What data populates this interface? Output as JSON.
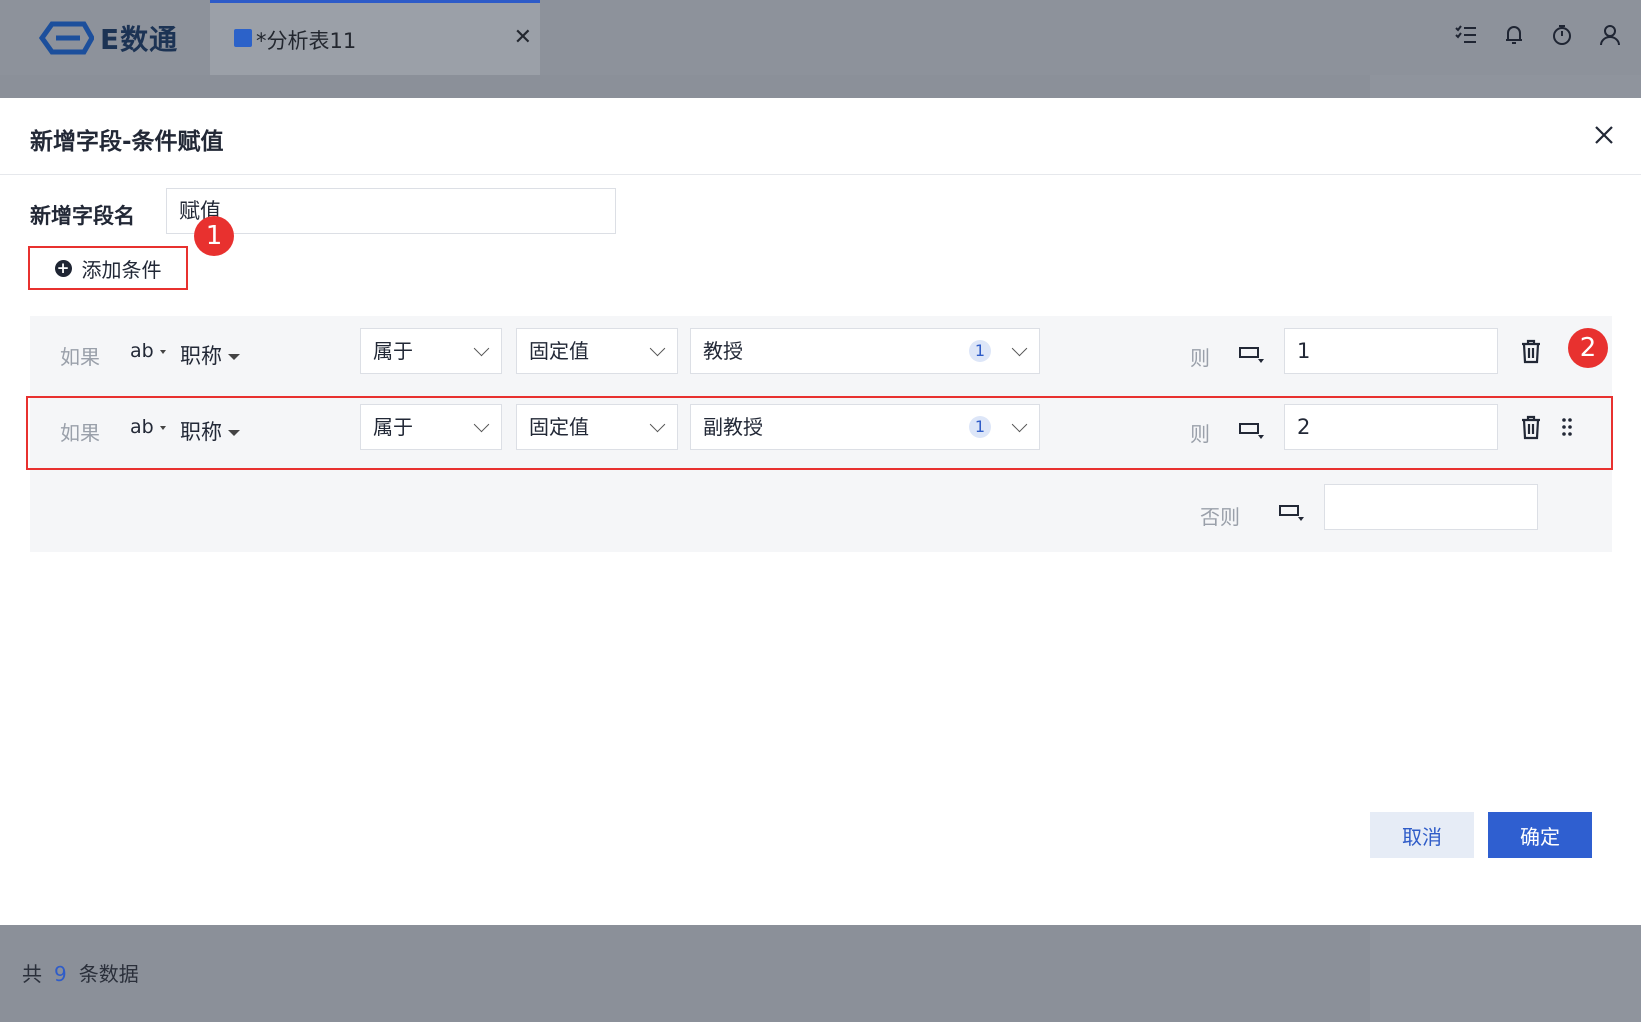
{
  "app": {
    "brand": "E数通",
    "tab_label": "*分析表11"
  },
  "modal": {
    "title": "新增字段-条件赋值",
    "field_name_label": "新增字段名",
    "field_name_value": "赋值",
    "add_condition_label": "添加条件",
    "annotation_1": "1",
    "annotation_2": "2",
    "conditions": [
      {
        "if_label": "如果",
        "type_icon": "ab",
        "field": "职称",
        "operator": "属于",
        "value_type": "固定值",
        "value": "教授",
        "count": "1",
        "then_label": "则",
        "result": "1"
      },
      {
        "if_label": "如果",
        "type_icon": "ab",
        "field": "职称",
        "operator": "属于",
        "value_type": "固定值",
        "value": "副教授",
        "count": "1",
        "then_label": "则",
        "result": "2"
      }
    ],
    "else_label": "否则",
    "else_value": "",
    "cancel_label": "取消",
    "ok_label": "确定"
  },
  "footer": {
    "prefix": "共",
    "count": "9",
    "suffix": "条数据"
  },
  "colors": {
    "accent": "#2f5fd0",
    "highlight": "#e8312f"
  }
}
